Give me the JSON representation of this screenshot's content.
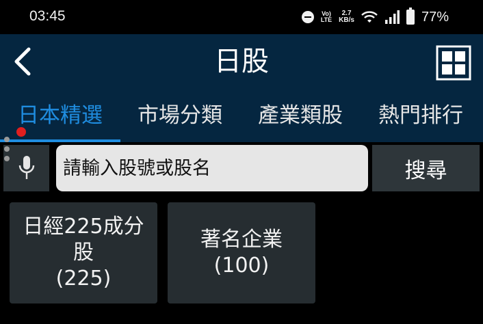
{
  "status_bar": {
    "time": "03:45",
    "volte_top": "Vo)",
    "volte_bottom": "LTE",
    "net_speed_value": "2.7",
    "net_speed_unit": "KB/s",
    "battery": "77%"
  },
  "header": {
    "title": "日股",
    "back_icon": "chevron-left-icon",
    "menu_icon": "grid-icon"
  },
  "tabs": [
    {
      "label": "日本精選",
      "active": true
    },
    {
      "label": "市場分類",
      "active": false
    },
    {
      "label": "產業類股",
      "active": false
    },
    {
      "label": "熱門排行",
      "active": false
    }
  ],
  "search": {
    "placeholder": "請輸入股號或股名",
    "value": "",
    "button_label": "搜尋"
  },
  "categories": [
    {
      "line1": "日經225成分",
      "line2": "股",
      "count": "(225)"
    },
    {
      "line1": "著名企業",
      "line2": "",
      "count": "(100)"
    }
  ],
  "colors": {
    "header_bg": "#052640",
    "accent": "#1f8de0",
    "card_bg": "#262d31"
  }
}
